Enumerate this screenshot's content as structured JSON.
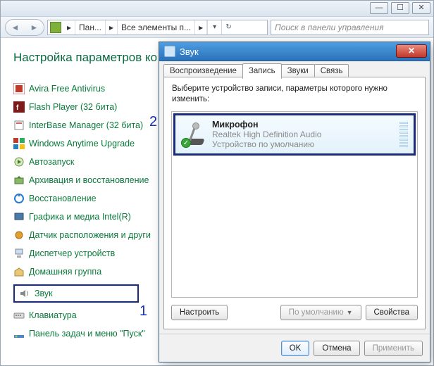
{
  "window": {
    "min_glyph": "—",
    "max_glyph": "☐",
    "close_glyph": "✕"
  },
  "addressbar": {
    "seg1": "Пан...",
    "seg2": "Все элементы п...",
    "chevron": "▸",
    "dropdown": "▾",
    "refresh": "↻"
  },
  "search": {
    "placeholder": "Поиск в панели управления"
  },
  "cp": {
    "heading": "Настройка параметров ко",
    "items": [
      {
        "label": "Avira Free Antivirus",
        "icon": "avira"
      },
      {
        "label": "Flash Player (32 бита)",
        "icon": "flash"
      },
      {
        "label": "InterBase Manager (32 бита)",
        "icon": "interbase"
      },
      {
        "label": "Windows Anytime Upgrade",
        "icon": "anytime"
      },
      {
        "label": "Автозапуск",
        "icon": "autoplay"
      },
      {
        "label": "Архивация и восстановление",
        "icon": "backup"
      },
      {
        "label": "Восстановление",
        "icon": "recovery"
      },
      {
        "label": "Графика и медиа Intel(R)",
        "icon": "intel"
      },
      {
        "label": "Датчик расположения и други",
        "icon": "sensor"
      },
      {
        "label": "Диспетчер устройств",
        "icon": "devmgr"
      },
      {
        "label": "Домашняя группа",
        "icon": "homegroup"
      },
      {
        "label": "Звук",
        "icon": "sound",
        "boxed": true
      },
      {
        "label": "Клавиатура",
        "icon": "keyboard"
      },
      {
        "label": "Панель задач и меню \"Пуск\"",
        "icon": "taskbar"
      }
    ]
  },
  "annotations": {
    "one": "1",
    "two": "2"
  },
  "dialog": {
    "title": "Звук",
    "close_glyph": "✕",
    "tabs": {
      "playback": "Воспроизведение",
      "record": "Запись",
      "sounds": "Звуки",
      "comm": "Связь"
    },
    "instruction": "Выберите устройство записи, параметры которого нужно изменить:",
    "device": {
      "name": "Микрофон",
      "driver": "Realtek High Definition Audio",
      "status": "Устройство по умолчанию",
      "check": "✓"
    },
    "buttons": {
      "configure": "Настроить",
      "set_default": "По умолчанию",
      "properties": "Свойства"
    },
    "footer": {
      "ok": "OK",
      "cancel": "Отмена",
      "apply": "Применить"
    }
  }
}
